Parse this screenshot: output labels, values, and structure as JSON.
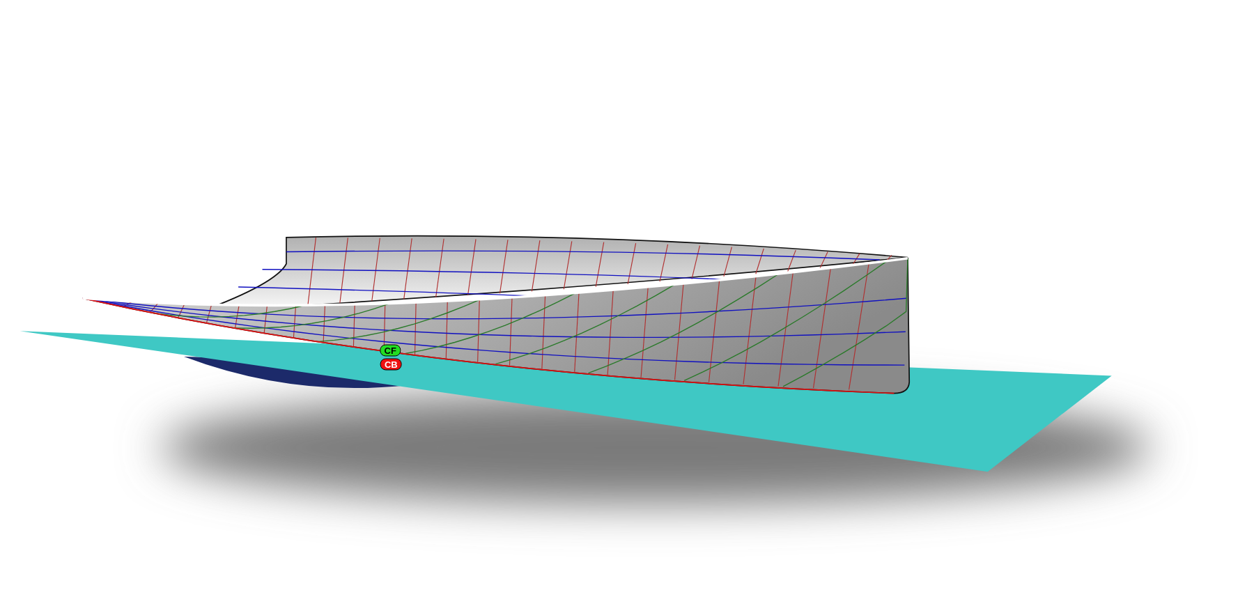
{
  "viewport": {
    "markers": [
      {
        "label": "CF",
        "color": "#22dd22"
      },
      {
        "label": "CB",
        "color": "#ee1111"
      }
    ]
  }
}
